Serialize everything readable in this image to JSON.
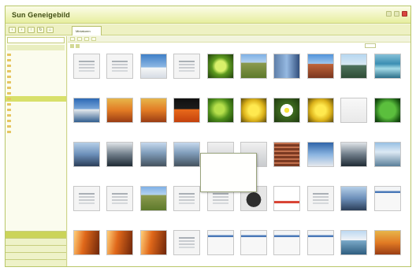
{
  "app": {
    "title": "Sun Geneigebild",
    "status_text": "",
    "active_tab": "Miniaturen"
  },
  "sidebar": {
    "search_placeholder": "",
    "filter_label": "",
    "tree": [
      "",
      "",
      "",
      "",
      "",
      "",
      "",
      "",
      "",
      "",
      "",
      "",
      "",
      "",
      ""
    ],
    "bottom_bars": [
      "",
      "",
      "",
      "",
      ""
    ]
  },
  "content": {
    "toolbar_items": [
      "",
      "",
      "",
      ""
    ],
    "zoom_label": ""
  },
  "thumbnails": [
    {
      "type": "t-doc",
      "caption": ""
    },
    {
      "type": "t-doc",
      "caption": ""
    },
    {
      "type": "t-sky",
      "caption": ""
    },
    {
      "type": "t-doc",
      "caption": ""
    },
    {
      "type": "t-green",
      "caption": ""
    },
    {
      "type": "t-field",
      "caption": ""
    },
    {
      "type": "t-people",
      "caption": ""
    },
    {
      "type": "t-desert",
      "caption": ""
    },
    {
      "type": "t-mountain",
      "caption": ""
    },
    {
      "type": "t-wave",
      "caption": ""
    },
    {
      "type": "t-sea",
      "caption": ""
    },
    {
      "type": "t-sunset",
      "caption": ""
    },
    {
      "type": "t-sunset",
      "caption": ""
    },
    {
      "type": "t-dark",
      "caption": ""
    },
    {
      "type": "t-leaf",
      "caption": ""
    },
    {
      "type": "t-yellow",
      "caption": ""
    },
    {
      "type": "t-flower",
      "caption": ""
    },
    {
      "type": "t-yellow",
      "caption": ""
    },
    {
      "type": "t-white",
      "caption": ""
    },
    {
      "type": "t-greenball",
      "caption": ""
    },
    {
      "type": "t-city",
      "caption": ""
    },
    {
      "type": "t-bw",
      "caption": ""
    },
    {
      "type": "t-bridge",
      "caption": ""
    },
    {
      "type": "t-bridge",
      "caption": ""
    },
    {
      "type": "t-shot",
      "caption": ""
    },
    {
      "type": "t-shot",
      "caption": ""
    },
    {
      "type": "t-brick",
      "caption": ""
    },
    {
      "type": "t-blue2",
      "caption": ""
    },
    {
      "type": "t-bw",
      "caption": ""
    },
    {
      "type": "t-coast",
      "caption": ""
    },
    {
      "type": "t-doc",
      "caption": ""
    },
    {
      "type": "t-doc",
      "caption": ""
    },
    {
      "type": "t-field",
      "caption": ""
    },
    {
      "type": "t-doc",
      "caption": ""
    },
    {
      "type": "t-doc",
      "caption": ""
    },
    {
      "type": "t-black",
      "caption": ""
    },
    {
      "type": "t-redchart",
      "caption": ""
    },
    {
      "type": "t-doc",
      "caption": ""
    },
    {
      "type": "t-city",
      "caption": ""
    },
    {
      "type": "t-webpage",
      "caption": ""
    },
    {
      "type": "t-orange",
      "caption": ""
    },
    {
      "type": "t-orange",
      "caption": ""
    },
    {
      "type": "t-orange",
      "caption": ""
    },
    {
      "type": "t-doc",
      "caption": ""
    },
    {
      "type": "t-webpage",
      "caption": ""
    },
    {
      "type": "t-webpage",
      "caption": ""
    },
    {
      "type": "t-webpage",
      "caption": ""
    },
    {
      "type": "t-webpage",
      "caption": ""
    },
    {
      "type": "t-lake",
      "caption": ""
    },
    {
      "type": "t-sunset",
      "caption": ""
    }
  ],
  "popup": {
    "title": "",
    "lines": [
      "",
      "",
      "",
      ""
    ]
  }
}
